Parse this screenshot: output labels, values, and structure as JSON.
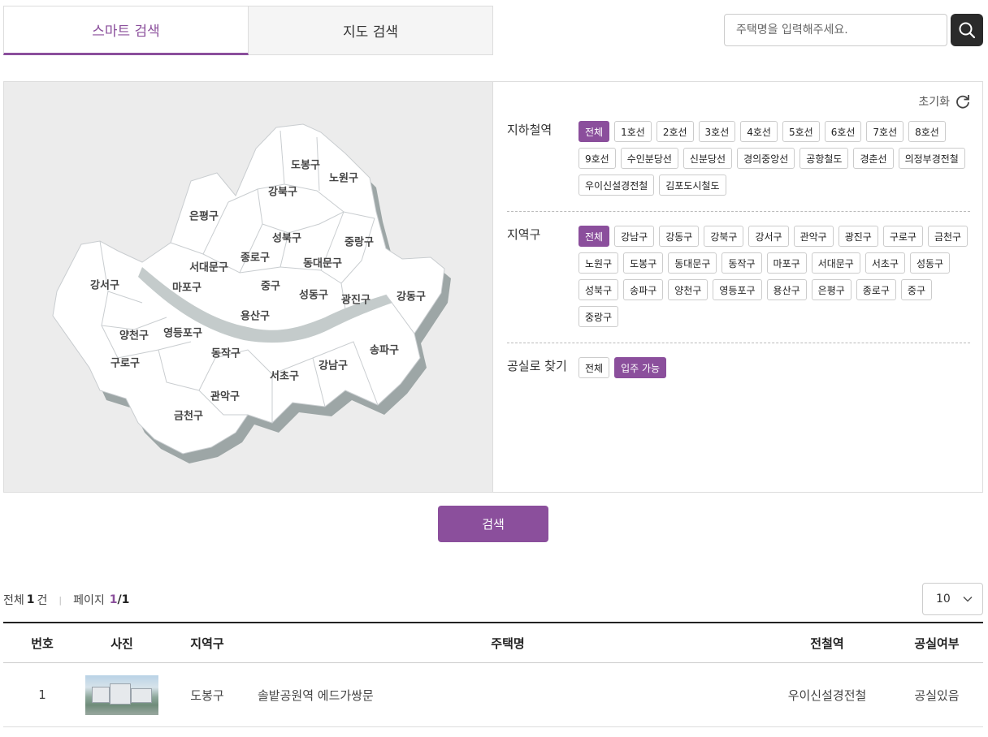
{
  "tabs": [
    {
      "label": "스마트 검색",
      "active": true
    },
    {
      "label": "지도 검색",
      "active": false
    }
  ],
  "search": {
    "placeholder": "주택명을 입력해주세요.",
    "icon": "search-icon"
  },
  "map": {
    "districts": [
      "도봉구",
      "노원구",
      "강북구",
      "은평구",
      "성북구",
      "중랑구",
      "종로구",
      "서대문구",
      "동대문구",
      "강서구",
      "마포구",
      "중구",
      "성동구",
      "광진구",
      "강동구",
      "용산구",
      "양천구",
      "영등포구",
      "동작구",
      "구로구",
      "송파구",
      "강남구",
      "서초구",
      "관악구",
      "금천구"
    ]
  },
  "filters": {
    "reset_label": "초기화",
    "subway": {
      "label": "지하철역",
      "options": [
        "전체",
        "1호선",
        "2호선",
        "3호선",
        "4호선",
        "5호선",
        "6호선",
        "7호선",
        "8호선",
        "9호선",
        "수인분당선",
        "신분당선",
        "경의중앙선",
        "공항철도",
        "경춘선",
        "의정부경전철",
        "우이신설경전철",
        "김포도시철도"
      ],
      "selected": "전체"
    },
    "district": {
      "label": "지역구",
      "options": [
        "전체",
        "강남구",
        "강동구",
        "강북구",
        "강서구",
        "관악구",
        "광진구",
        "구로구",
        "금천구",
        "노원구",
        "도봉구",
        "동대문구",
        "동작구",
        "마포구",
        "서대문구",
        "서초구",
        "성동구",
        "성북구",
        "송파구",
        "양천구",
        "영등포구",
        "용산구",
        "은평구",
        "종로구",
        "중구",
        "중랑구"
      ],
      "selected": "전체"
    },
    "vacancy": {
      "label": "공실로 찾기",
      "options": [
        "전체",
        "입주 가능"
      ],
      "selected": "입주 가능"
    }
  },
  "submit_label": "검색",
  "results": {
    "total_prefix": "전체",
    "total_count": "1",
    "total_suffix": "건",
    "page_prefix": "페이지",
    "page_current": "1",
    "page_total": "/1",
    "per_page": "10"
  },
  "table": {
    "headers": [
      "번호",
      "사진",
      "지역구",
      "주택명",
      "전철역",
      "공실여부"
    ],
    "rows": [
      {
        "no": "1",
        "district": "도봉구",
        "name": "솔밭공원역 에드가쌍문",
        "station": "우이신설경전철",
        "vacancy": "공실있음"
      }
    ]
  },
  "colors": {
    "accent": "#8b4f9c",
    "dark": "#2b2b2b"
  }
}
